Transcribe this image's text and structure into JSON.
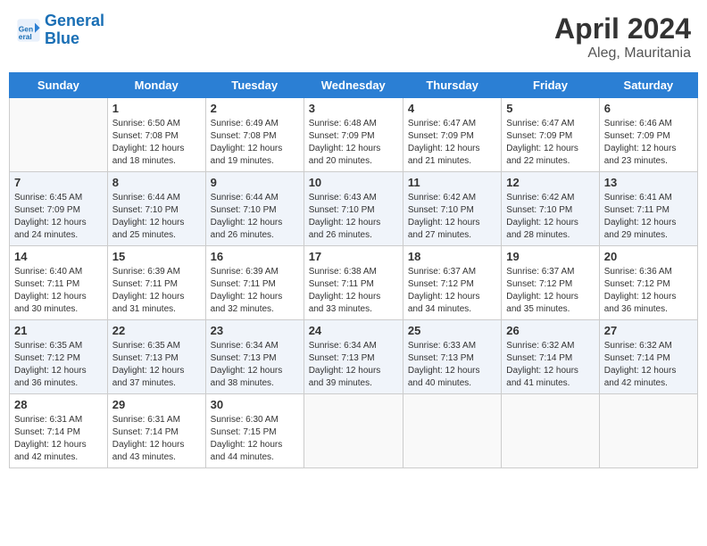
{
  "header": {
    "logo_line1": "General",
    "logo_line2": "Blue",
    "title": "April 2024",
    "subtitle": "Aleg, Mauritania"
  },
  "days_of_week": [
    "Sunday",
    "Monday",
    "Tuesday",
    "Wednesday",
    "Thursday",
    "Friday",
    "Saturday"
  ],
  "weeks": [
    [
      {
        "day": "",
        "info": ""
      },
      {
        "day": "1",
        "info": "Sunrise: 6:50 AM\nSunset: 7:08 PM\nDaylight: 12 hours\nand 18 minutes."
      },
      {
        "day": "2",
        "info": "Sunrise: 6:49 AM\nSunset: 7:08 PM\nDaylight: 12 hours\nand 19 minutes."
      },
      {
        "day": "3",
        "info": "Sunrise: 6:48 AM\nSunset: 7:09 PM\nDaylight: 12 hours\nand 20 minutes."
      },
      {
        "day": "4",
        "info": "Sunrise: 6:47 AM\nSunset: 7:09 PM\nDaylight: 12 hours\nand 21 minutes."
      },
      {
        "day": "5",
        "info": "Sunrise: 6:47 AM\nSunset: 7:09 PM\nDaylight: 12 hours\nand 22 minutes."
      },
      {
        "day": "6",
        "info": "Sunrise: 6:46 AM\nSunset: 7:09 PM\nDaylight: 12 hours\nand 23 minutes."
      }
    ],
    [
      {
        "day": "7",
        "info": "Sunrise: 6:45 AM\nSunset: 7:09 PM\nDaylight: 12 hours\nand 24 minutes."
      },
      {
        "day": "8",
        "info": "Sunrise: 6:44 AM\nSunset: 7:10 PM\nDaylight: 12 hours\nand 25 minutes."
      },
      {
        "day": "9",
        "info": "Sunrise: 6:44 AM\nSunset: 7:10 PM\nDaylight: 12 hours\nand 26 minutes."
      },
      {
        "day": "10",
        "info": "Sunrise: 6:43 AM\nSunset: 7:10 PM\nDaylight: 12 hours\nand 26 minutes."
      },
      {
        "day": "11",
        "info": "Sunrise: 6:42 AM\nSunset: 7:10 PM\nDaylight: 12 hours\nand 27 minutes."
      },
      {
        "day": "12",
        "info": "Sunrise: 6:42 AM\nSunset: 7:10 PM\nDaylight: 12 hours\nand 28 minutes."
      },
      {
        "day": "13",
        "info": "Sunrise: 6:41 AM\nSunset: 7:11 PM\nDaylight: 12 hours\nand 29 minutes."
      }
    ],
    [
      {
        "day": "14",
        "info": "Sunrise: 6:40 AM\nSunset: 7:11 PM\nDaylight: 12 hours\nand 30 minutes."
      },
      {
        "day": "15",
        "info": "Sunrise: 6:39 AM\nSunset: 7:11 PM\nDaylight: 12 hours\nand 31 minutes."
      },
      {
        "day": "16",
        "info": "Sunrise: 6:39 AM\nSunset: 7:11 PM\nDaylight: 12 hours\nand 32 minutes."
      },
      {
        "day": "17",
        "info": "Sunrise: 6:38 AM\nSunset: 7:11 PM\nDaylight: 12 hours\nand 33 minutes."
      },
      {
        "day": "18",
        "info": "Sunrise: 6:37 AM\nSunset: 7:12 PM\nDaylight: 12 hours\nand 34 minutes."
      },
      {
        "day": "19",
        "info": "Sunrise: 6:37 AM\nSunset: 7:12 PM\nDaylight: 12 hours\nand 35 minutes."
      },
      {
        "day": "20",
        "info": "Sunrise: 6:36 AM\nSunset: 7:12 PM\nDaylight: 12 hours\nand 36 minutes."
      }
    ],
    [
      {
        "day": "21",
        "info": "Sunrise: 6:35 AM\nSunset: 7:12 PM\nDaylight: 12 hours\nand 36 minutes."
      },
      {
        "day": "22",
        "info": "Sunrise: 6:35 AM\nSunset: 7:13 PM\nDaylight: 12 hours\nand 37 minutes."
      },
      {
        "day": "23",
        "info": "Sunrise: 6:34 AM\nSunset: 7:13 PM\nDaylight: 12 hours\nand 38 minutes."
      },
      {
        "day": "24",
        "info": "Sunrise: 6:34 AM\nSunset: 7:13 PM\nDaylight: 12 hours\nand 39 minutes."
      },
      {
        "day": "25",
        "info": "Sunrise: 6:33 AM\nSunset: 7:13 PM\nDaylight: 12 hours\nand 40 minutes."
      },
      {
        "day": "26",
        "info": "Sunrise: 6:32 AM\nSunset: 7:14 PM\nDaylight: 12 hours\nand 41 minutes."
      },
      {
        "day": "27",
        "info": "Sunrise: 6:32 AM\nSunset: 7:14 PM\nDaylight: 12 hours\nand 42 minutes."
      }
    ],
    [
      {
        "day": "28",
        "info": "Sunrise: 6:31 AM\nSunset: 7:14 PM\nDaylight: 12 hours\nand 42 minutes."
      },
      {
        "day": "29",
        "info": "Sunrise: 6:31 AM\nSunset: 7:14 PM\nDaylight: 12 hours\nand 43 minutes."
      },
      {
        "day": "30",
        "info": "Sunrise: 6:30 AM\nSunset: 7:15 PM\nDaylight: 12 hours\nand 44 minutes."
      },
      {
        "day": "",
        "info": ""
      },
      {
        "day": "",
        "info": ""
      },
      {
        "day": "",
        "info": ""
      },
      {
        "day": "",
        "info": ""
      }
    ]
  ]
}
